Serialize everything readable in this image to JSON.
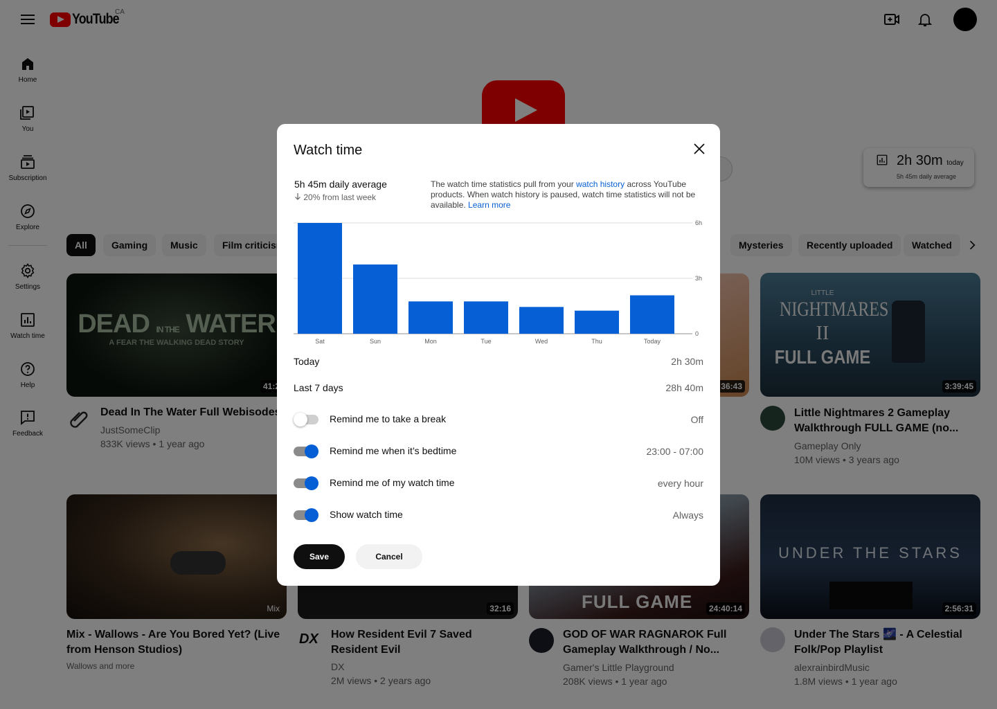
{
  "topbar": {
    "logo_text": "YouTube",
    "country": "CA",
    "icons": [
      "menu-icon",
      "create-icon",
      "bell-icon"
    ]
  },
  "sidebar": {
    "items": [
      {
        "label": "Home",
        "icon": "home-icon"
      },
      {
        "label": "You",
        "icon": "library-icon"
      },
      {
        "label": "Subscription",
        "icon": "subscriptions-icon"
      },
      {
        "label": "Explore",
        "icon": "compass-icon"
      },
      {
        "label": "Settings",
        "icon": "gear-icon"
      },
      {
        "label": "Watch time",
        "icon": "bar-chart-icon"
      },
      {
        "label": "Help",
        "icon": "help-icon"
      },
      {
        "label": "Feedback",
        "icon": "feedback-icon"
      }
    ]
  },
  "watch_card": {
    "value": "2h 30m",
    "suffix": "today",
    "sub": "5h 45m daily average"
  },
  "chips": [
    "All",
    "Gaming",
    "Music",
    "Film criticisms",
    "Mysteries",
    "Recently uploaded",
    "Watched"
  ],
  "videos": [
    {
      "title": "Dead In The Water Full Webisodes",
      "channel": "JustSomeClip",
      "meta": "833K views • 1 year ago",
      "duration": "41:2"
    },
    {
      "title": "",
      "channel": "",
      "meta": "",
      "duration": "36:43"
    },
    {
      "title": "Little Nightmares 2 Gameplay Walkthrough FULL GAME (no...",
      "channel": "Gameplay Only",
      "meta": "10M views • 3 years ago",
      "duration": "3:39:45"
    },
    {
      "title": "Mix - Wallows - Are You Bored Yet? (Live from Henson Studios)",
      "channel": "Wallows and more",
      "meta": "",
      "duration": "Mix"
    },
    {
      "title": "How Resident Evil 7 Saved Resident Evil",
      "channel": "DX",
      "meta": "2M views • 2 years ago",
      "duration": "32:16"
    },
    {
      "title": "GOD OF WAR RAGNAROK Full Gameplay Walkthrough / No...",
      "channel": "Gamer's Little Playground",
      "meta": "208K views • 1 year ago",
      "duration": "24:40:14"
    },
    {
      "title": "Under The Stars 🌌 - A Celestial Folk/Pop Playlist",
      "channel": "alexrainbirdMusic",
      "meta": "1.8M views • 1 year ago",
      "duration": "2:56:31"
    }
  ],
  "thumb_text": {
    "dead1": "DEAD",
    "dead2": "WATER",
    "dead3": "A FEAR THE WALKING DEAD STORY",
    "ln_small": "LITTLE",
    "ln1": "NIGHTMARES",
    "ln2": "II",
    "ln3": "FULL GAME",
    "gow": "FULL GAME",
    "stars": "UNDER THE STARS"
  },
  "dialog": {
    "title": "Watch time",
    "average": "5h 45m daily average",
    "trend": "20% from last week",
    "info_pre": "The watch time statistics pull from your ",
    "info_link": "watch history",
    "info_post": " across YouTube products. When watch history is paused, watch time statistics will not be available. ",
    "learn_more": "Learn more",
    "today_label": "Today",
    "today_value": "2h 30m",
    "last7_label": "Last 7 days",
    "last7_value": "28h 40m",
    "toggles": [
      {
        "label": "Remind me to take a break",
        "value": "Off",
        "on": false
      },
      {
        "label": "Remind me when it’s bedtime",
        "value": "23:00 - 07:00",
        "on": true
      },
      {
        "label": "Remind me of my watch time",
        "value": "every hour",
        "on": true
      },
      {
        "label": "Show watch time",
        "value": "Always",
        "on": true
      }
    ],
    "save": "Save",
    "cancel": "Cancel"
  },
  "chart_data": {
    "type": "bar",
    "categories": [
      "Sat",
      "Sun",
      "Mon",
      "Tue",
      "Wed",
      "Thu",
      "Today"
    ],
    "values": [
      6.0,
      3.75,
      1.75,
      1.75,
      1.45,
      1.25,
      2.08
    ],
    "y_ticks": [
      "0",
      "3h",
      "6h"
    ],
    "ylim": [
      0,
      6
    ],
    "grid": true,
    "color": "#065fd4"
  }
}
